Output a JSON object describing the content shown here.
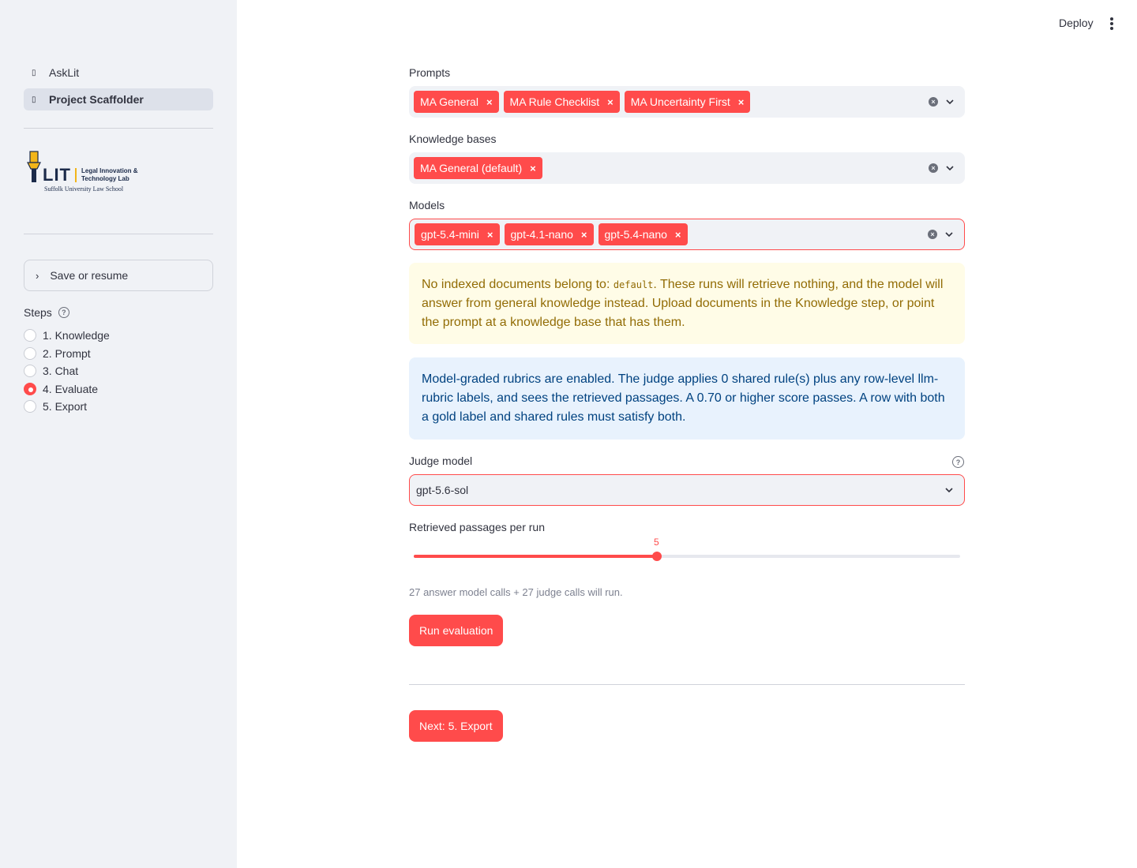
{
  "sidebar": {
    "nav": [
      {
        "label": "AskLit",
        "icon": "page-icon"
      },
      {
        "label": "Project Scaffolder",
        "icon": "page-icon"
      }
    ],
    "logo": {
      "mark": "LIT",
      "line1": "Legal Innovation &",
      "line2": "Technology Lab",
      "school": "Suffolk University Law School",
      "colors": {
        "navy": "#1c2b4a",
        "gold": "#f2b519"
      }
    },
    "expander_label": "Save or resume",
    "steps_label": "Steps",
    "steps": [
      "1. Knowledge",
      "2. Prompt",
      "3. Chat",
      "4. Evaluate",
      "5. Export"
    ],
    "selected_step": "4. Evaluate"
  },
  "header": {
    "deploy_label": "Deploy"
  },
  "main": {
    "prompts": {
      "label": "Prompts",
      "tags": [
        "MA General",
        "MA Rule Checklist",
        "MA Uncertainty First"
      ]
    },
    "knowledge_bases": {
      "label": "Knowledge bases",
      "tags": [
        "MA General (default)"
      ]
    },
    "models": {
      "label": "Models",
      "tags": [
        "gpt-5.4-mini",
        "gpt-4.1-nano",
        "gpt-5.4-nano"
      ]
    },
    "warning": {
      "before": "No indexed documents belong to: ",
      "code": "default",
      "after": ". These runs will retrieve nothing, and the model will answer from general knowledge instead. Upload documents in the Knowledge step, or point the prompt at a knowledge base that has them."
    },
    "info": "Model-graded rubrics are enabled. The judge applies 0 shared rule(s) plus any row-level llm-rubric labels, and sees the retrieved passages. A 0.70 or higher score passes. A row with both a gold label and shared rules must satisfy both.",
    "judge": {
      "label": "Judge model",
      "value": "gpt-5.6-sol"
    },
    "slider": {
      "label": "Retrieved passages per run",
      "value": "5",
      "fraction": 0.445
    },
    "caption": "27 answer model calls + 27 judge calls will run.",
    "run_button": "Run evaluation",
    "next_button": "Next: 5. Export"
  },
  "colors": {
    "accent": "#ff4b4b",
    "sidebar_bg": "#f0f2f6",
    "warning_bg": "#fffce7",
    "info_bg": "#e8f2fd"
  }
}
